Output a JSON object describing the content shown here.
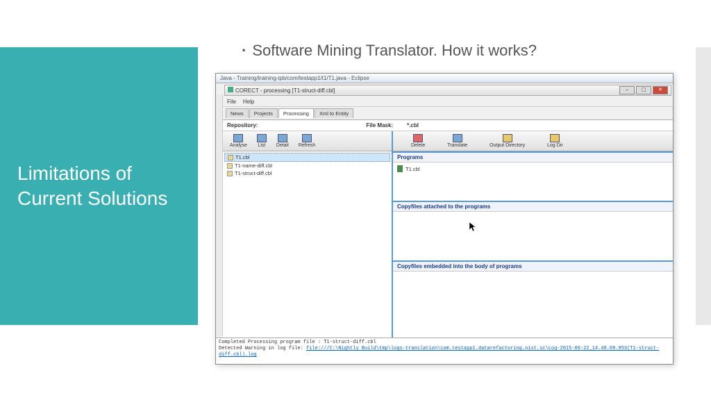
{
  "slide": {
    "panel_title": "Limitations of Current Solutions",
    "bullet": "Software Mining Translator. How it works?"
  },
  "eclipse_title": "Java - Training/training-ipb/com/testapp1/t1/T1.java - Eclipse",
  "inner_title": "CORECT - processing [T1-struct-diff.cbl]",
  "menu": {
    "file": "File",
    "help": "Help"
  },
  "tabs": [
    "News",
    "Projects",
    "Processing",
    "Xml to Entity"
  ],
  "active_tab": 2,
  "repo": {
    "label": "Repository:",
    "mask_label": "File Mask:",
    "mask_value": "*.cbl"
  },
  "left_toolbar": [
    {
      "name": "analyse",
      "label": "Analyse"
    },
    {
      "name": "list",
      "label": "List"
    },
    {
      "name": "detail",
      "label": "Detail"
    },
    {
      "name": "refresh",
      "label": "Refresh"
    }
  ],
  "right_toolbar": [
    {
      "name": "delete",
      "label": "Delete"
    },
    {
      "name": "translate",
      "label": "Translate"
    },
    {
      "name": "output-directory",
      "label": "Output Directory"
    },
    {
      "name": "log-dir",
      "label": "Log Dir"
    }
  ],
  "files": [
    {
      "name": "T1.cbl",
      "selected": true
    },
    {
      "name": "T1-name-diff.cbl",
      "selected": false
    },
    {
      "name": "T1-struct-diff.cbl",
      "selected": false
    }
  ],
  "sections": {
    "programs": {
      "title": "Programs",
      "items": [
        "T1.cbl"
      ]
    },
    "attached": {
      "title": "Copyfiles attached to the programs"
    },
    "embedded": {
      "title": "Copyfiles embedded into the body of programs"
    }
  },
  "log": {
    "line1": "Completed Processing program file : T1-struct-diff.cbl",
    "line2_prefix": "   Detected Warning in log file: ",
    "line2_link": "file:///C:\\Nightly Build\\tmp\\logs-translation\\com.testapp1.datarefactoring.nist.sc\\Log-2015-06-22_14.40.09.953(T1-struct-diff.cbl).log"
  }
}
